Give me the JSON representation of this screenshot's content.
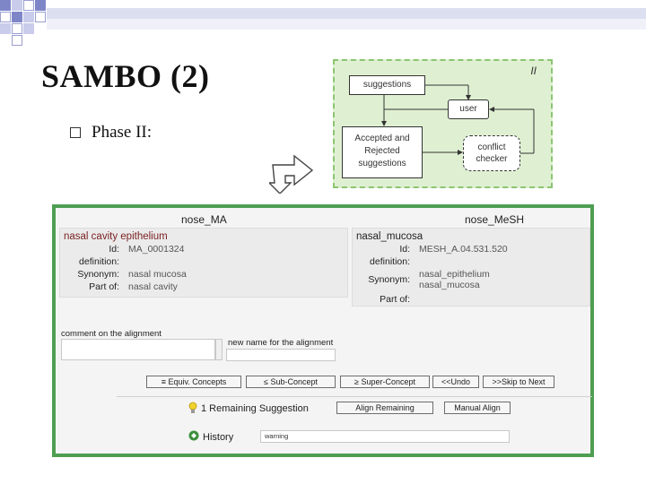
{
  "slide": {
    "title": "SAMBO (2)",
    "bullet_text": "Phase II:"
  },
  "workflow": {
    "roman": "II",
    "suggestions": "suggestions",
    "user": "user",
    "accepted_rejected": "Accepted and Rejected suggestions",
    "conflict_checker": "conflict checker",
    "border_color": "#8cc572",
    "background_color": "#dff0d2"
  },
  "ui": {
    "left_header": "nose_MA",
    "right_header": "nose_MeSH",
    "left_concept": {
      "name": "nasal cavity epithelium",
      "labels": {
        "id": "Id:",
        "definition": "definition:",
        "synonym": "Synonym:",
        "part_of": "Part of:"
      },
      "id": "MA_0001324",
      "definition": "",
      "synonym": "nasal mucosa",
      "part_of": "nasal cavity"
    },
    "right_concept": {
      "name": "nasal_mucosa",
      "labels": {
        "id": "Id:",
        "definition": "definition:",
        "synonym": "Synonym:",
        "part_of": "Part of:"
      },
      "id": "MESH_A.04.531.520",
      "definition": "",
      "synonym_1": "nasal_epithelium",
      "synonym_2": "nasal_mucosa",
      "part_of": ""
    },
    "comment_label": "comment on the alignment",
    "comment_value": "",
    "new_name_label": "new name for the alignment",
    "new_name_value": "",
    "buttons": {
      "equiv": "≡ Equiv. Concepts",
      "sub": "≤ Sub-Concept",
      "super": "≥ Super-Concept",
      "undo": "<<Undo",
      "skip": ">>Skip to Next",
      "align_remaining": "Align Remaining",
      "manual_align": "Manual Align"
    },
    "remaining_suggestion": "1 Remaining Suggestion",
    "history_label": "History",
    "history_value": "warning",
    "panel_color": "#4e9e52",
    "concept_name_color": "#7a1f1f"
  }
}
